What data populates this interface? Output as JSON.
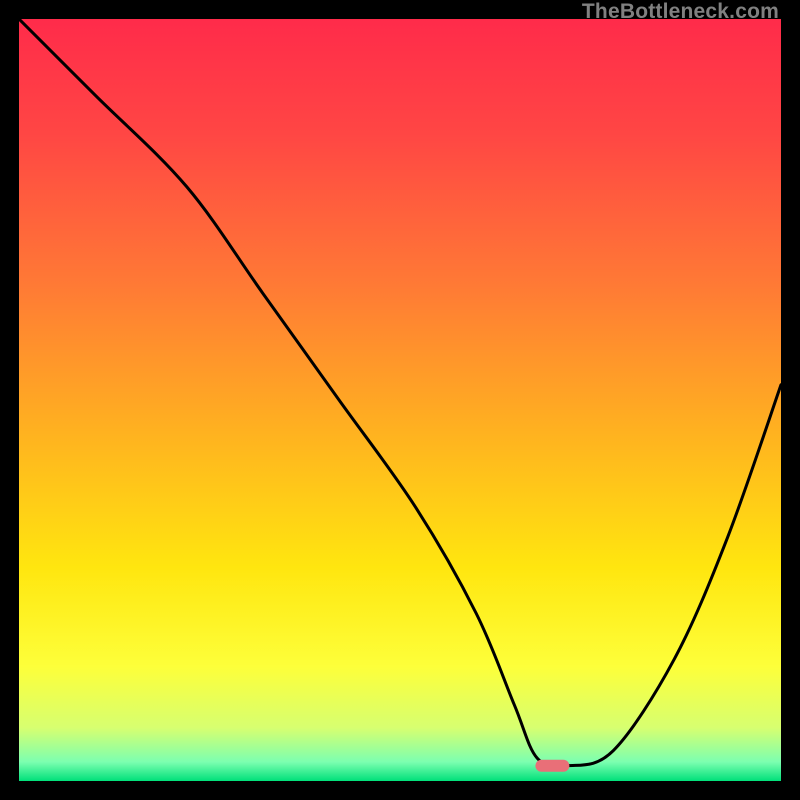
{
  "watermark": "TheBottleneck.com",
  "chart_data": {
    "type": "line",
    "title": "",
    "xlabel": "",
    "ylabel": "",
    "xlim": [
      0,
      100
    ],
    "ylim": [
      0,
      100
    ],
    "series": [
      {
        "name": "bottleneck-curve",
        "x": [
          0,
          10,
          22,
          32,
          42,
          52,
          60,
          65,
          68,
          72,
          78,
          86,
          93,
          100
        ],
        "y": [
          100,
          90,
          78,
          64,
          50,
          36,
          22,
          10,
          3,
          2,
          4,
          16,
          32,
          52
        ]
      }
    ],
    "marker": {
      "x": 70,
      "y": 2,
      "color": "#e96f78"
    },
    "gradient_stops": [
      {
        "offset": 0.0,
        "color": "#ff2b4a"
      },
      {
        "offset": 0.15,
        "color": "#ff4644"
      },
      {
        "offset": 0.35,
        "color": "#ff7a35"
      },
      {
        "offset": 0.55,
        "color": "#ffb41f"
      },
      {
        "offset": 0.72,
        "color": "#ffe60f"
      },
      {
        "offset": 0.85,
        "color": "#fdff3a"
      },
      {
        "offset": 0.93,
        "color": "#d7ff70"
      },
      {
        "offset": 0.975,
        "color": "#7cffb0"
      },
      {
        "offset": 1.0,
        "color": "#00e07a"
      }
    ]
  }
}
